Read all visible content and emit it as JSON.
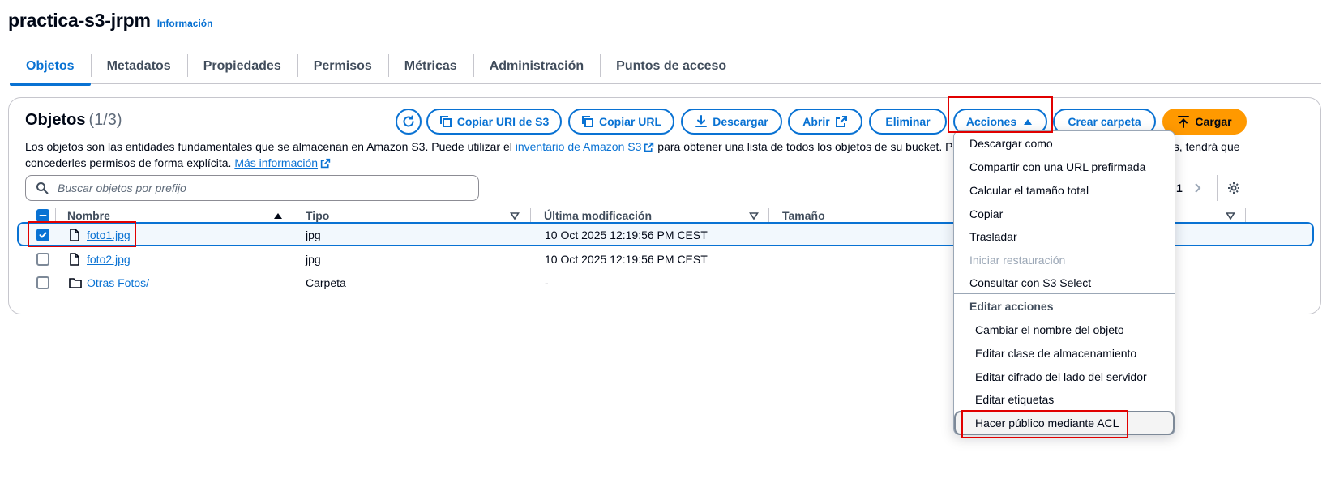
{
  "page": {
    "title": "practica-s3-jrpm",
    "info_link": "Información"
  },
  "tabs": [
    {
      "label": "Objetos",
      "active": true
    },
    {
      "label": "Metadatos"
    },
    {
      "label": "Propiedades"
    },
    {
      "label": "Permisos"
    },
    {
      "label": "Métricas"
    },
    {
      "label": "Administración"
    },
    {
      "label": "Puntos de acceso"
    }
  ],
  "objects": {
    "title": "Objetos",
    "count": "(1/3)",
    "buttons": {
      "refresh_icon": "refresh-icon",
      "copy_s3_uri": "Copiar URI de S3",
      "copy_url": "Copiar URL",
      "download": "Descargar",
      "open": "Abrir",
      "delete": "Eliminar",
      "actions": "Acciones",
      "create_folder": "Crear carpeta",
      "upload": "Cargar"
    },
    "description": {
      "part1": "Los objetos son las entidades fundamentales que se almacenan en Amazon S3. Puede utilizar el",
      "link1": "inventario de Amazon S3",
      "part2": "para obtener una lista de todos los objetos de su bucket. Para que",
      "part3": "os, tendrá que",
      "part4": "concederles permisos de forma explícita.",
      "link2": "Más información"
    },
    "search_placeholder": "Buscar objetos por prefijo",
    "pagination": {
      "current_page": "1"
    },
    "columns": {
      "name": "Nombre",
      "type": "Tipo",
      "modified": "Última modificación",
      "size": "Tamaño"
    },
    "rows": [
      {
        "name": "foto1.jpg",
        "type": "jpg",
        "modified": "10 Oct 2025 12:19:56 PM CEST",
        "selected": true,
        "icon": "file-icon"
      },
      {
        "name": "foto2.jpg",
        "type": "jpg",
        "modified": "10 Oct 2025 12:19:56 PM CEST",
        "selected": false,
        "icon": "file-icon"
      },
      {
        "name": "Otras Fotos/",
        "type": "Carpeta",
        "modified": "-",
        "selected": false,
        "icon": "folder-icon"
      }
    ]
  },
  "actions_menu": {
    "items": [
      {
        "label": "Descargar como"
      },
      {
        "label": "Compartir con una URL prefirmada"
      },
      {
        "label": "Calcular el tamaño total"
      },
      {
        "label": "Copiar"
      },
      {
        "label": "Trasladar"
      },
      {
        "label": "Iniciar restauración",
        "disabled": true
      },
      {
        "label": "Consultar con S3 Select"
      }
    ],
    "group_label": "Editar acciones",
    "group_items": [
      {
        "label": "Cambiar el nombre del objeto"
      },
      {
        "label": "Editar clase de almacenamiento"
      },
      {
        "label": "Editar cifrado del lado del servidor"
      },
      {
        "label": "Editar etiquetas"
      },
      {
        "label": "Hacer público mediante ACL",
        "highlighted": true
      }
    ]
  },
  "colors": {
    "accent": "#0972d3",
    "primary_button": "#ff9900",
    "annotation": "#e10000"
  }
}
